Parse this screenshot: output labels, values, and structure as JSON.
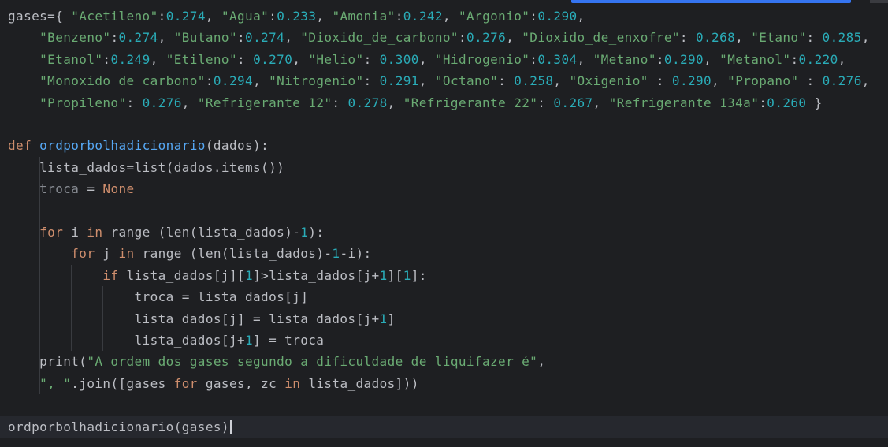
{
  "editor": {
    "colors": {
      "background": "#1e1f22",
      "default": "#bcbec4",
      "keyword": "#cf8e6d",
      "string": "#6aab73",
      "number": "#2aacb8",
      "function": "#56a8f5",
      "dimmed": "#868a91",
      "current_line": "#26282e",
      "accent": "#3574f0"
    },
    "lines": [
      {
        "tokens": [
          {
            "t": "gases={ ",
            "c": "default"
          },
          {
            "t": "\"Acetileno\"",
            "c": "str"
          },
          {
            "t": ":",
            "c": "default"
          },
          {
            "t": "0.274",
            "c": "num"
          },
          {
            "t": ", ",
            "c": "default"
          },
          {
            "t": "\"Agua\"",
            "c": "str"
          },
          {
            "t": ":",
            "c": "default"
          },
          {
            "t": "0.233",
            "c": "num"
          },
          {
            "t": ", ",
            "c": "default"
          },
          {
            "t": "\"Amonia\"",
            "c": "str"
          },
          {
            "t": ":",
            "c": "default"
          },
          {
            "t": "0.242",
            "c": "num"
          },
          {
            "t": ", ",
            "c": "default"
          },
          {
            "t": "\"Argonio\"",
            "c": "str"
          },
          {
            "t": ":",
            "c": "default"
          },
          {
            "t": "0.290",
            "c": "num"
          },
          {
            "t": ",",
            "c": "default"
          }
        ]
      },
      {
        "tokens": [
          {
            "t": "    ",
            "c": "default"
          },
          {
            "t": "\"Benzeno\"",
            "c": "str"
          },
          {
            "t": ":",
            "c": "default"
          },
          {
            "t": "0.274",
            "c": "num"
          },
          {
            "t": ", ",
            "c": "default"
          },
          {
            "t": "\"Butano\"",
            "c": "str"
          },
          {
            "t": ":",
            "c": "default"
          },
          {
            "t": "0.274",
            "c": "num"
          },
          {
            "t": ", ",
            "c": "default"
          },
          {
            "t": "\"Dioxido_de_carbono\"",
            "c": "str"
          },
          {
            "t": ":",
            "c": "default"
          },
          {
            "t": "0.276",
            "c": "num"
          },
          {
            "t": ", ",
            "c": "default"
          },
          {
            "t": "\"Dioxido_de_enxofre\"",
            "c": "str"
          },
          {
            "t": ": ",
            "c": "default"
          },
          {
            "t": "0.268",
            "c": "num"
          },
          {
            "t": ", ",
            "c": "default"
          },
          {
            "t": "\"Etano\"",
            "c": "str"
          },
          {
            "t": ": ",
            "c": "default"
          },
          {
            "t": "0.285",
            "c": "num"
          },
          {
            "t": ",",
            "c": "default"
          }
        ]
      },
      {
        "tokens": [
          {
            "t": "    ",
            "c": "default"
          },
          {
            "t": "\"Etanol\"",
            "c": "str"
          },
          {
            "t": ":",
            "c": "default"
          },
          {
            "t": "0.249",
            "c": "num"
          },
          {
            "t": ", ",
            "c": "default"
          },
          {
            "t": "\"Etileno\"",
            "c": "str"
          },
          {
            "t": ": ",
            "c": "default"
          },
          {
            "t": "0.270",
            "c": "num"
          },
          {
            "t": ", ",
            "c": "default"
          },
          {
            "t": "\"Helio\"",
            "c": "str"
          },
          {
            "t": ": ",
            "c": "default"
          },
          {
            "t": "0.300",
            "c": "num"
          },
          {
            "t": ", ",
            "c": "default"
          },
          {
            "t": "\"Hidrogenio\"",
            "c": "str"
          },
          {
            "t": ":",
            "c": "default"
          },
          {
            "t": "0.304",
            "c": "num"
          },
          {
            "t": ", ",
            "c": "default"
          },
          {
            "t": "\"Metano\"",
            "c": "str"
          },
          {
            "t": ":",
            "c": "default"
          },
          {
            "t": "0.290",
            "c": "num"
          },
          {
            "t": ", ",
            "c": "default"
          },
          {
            "t": "\"Metanol\"",
            "c": "str"
          },
          {
            "t": ":",
            "c": "default"
          },
          {
            "t": "0.220",
            "c": "num"
          },
          {
            "t": ",",
            "c": "default"
          }
        ]
      },
      {
        "tokens": [
          {
            "t": "    ",
            "c": "default"
          },
          {
            "t": "\"Monoxido_de_carbono\"",
            "c": "str"
          },
          {
            "t": ":",
            "c": "default"
          },
          {
            "t": "0.294",
            "c": "num"
          },
          {
            "t": ", ",
            "c": "default"
          },
          {
            "t": "\"Nitrogenio\"",
            "c": "str"
          },
          {
            "t": ": ",
            "c": "default"
          },
          {
            "t": "0.291",
            "c": "num"
          },
          {
            "t": ", ",
            "c": "default"
          },
          {
            "t": "\"Octano\"",
            "c": "str"
          },
          {
            "t": ": ",
            "c": "default"
          },
          {
            "t": "0.258",
            "c": "num"
          },
          {
            "t": ", ",
            "c": "default"
          },
          {
            "t": "\"Oxigenio\"",
            "c": "str"
          },
          {
            "t": " : ",
            "c": "default"
          },
          {
            "t": "0.290",
            "c": "num"
          },
          {
            "t": ", ",
            "c": "default"
          },
          {
            "t": "\"Propano\"",
            "c": "str"
          },
          {
            "t": " : ",
            "c": "default"
          },
          {
            "t": "0.276",
            "c": "num"
          },
          {
            "t": ",",
            "c": "default"
          }
        ]
      },
      {
        "tokens": [
          {
            "t": "    ",
            "c": "default"
          },
          {
            "t": "\"Propileno\"",
            "c": "str"
          },
          {
            "t": ": ",
            "c": "default"
          },
          {
            "t": "0.276",
            "c": "num"
          },
          {
            "t": ", ",
            "c": "default"
          },
          {
            "t": "\"Refrigerante_12\"",
            "c": "str"
          },
          {
            "t": ": ",
            "c": "default"
          },
          {
            "t": "0.278",
            "c": "num"
          },
          {
            "t": ", ",
            "c": "default"
          },
          {
            "t": "\"Refrigerante_22\"",
            "c": "str"
          },
          {
            "t": ": ",
            "c": "default"
          },
          {
            "t": "0.267",
            "c": "num"
          },
          {
            "t": ", ",
            "c": "default"
          },
          {
            "t": "\"Refrigerante_134a\"",
            "c": "str"
          },
          {
            "t": ":",
            "c": "default"
          },
          {
            "t": "0.260",
            "c": "num"
          },
          {
            "t": " }",
            "c": "default"
          }
        ]
      },
      {
        "tokens": []
      },
      {
        "tokens": [
          {
            "t": "def ",
            "c": "kw"
          },
          {
            "t": "ordporbolhadicionario",
            "c": "fn"
          },
          {
            "t": "(dados):",
            "c": "default"
          }
        ]
      },
      {
        "tokens": [
          {
            "t": "    lista_dados=list(dados.items())",
            "c": "default"
          }
        ]
      },
      {
        "tokens": [
          {
            "t": "    ",
            "c": "default"
          },
          {
            "t": "troca",
            "c": "dim"
          },
          {
            "t": " = ",
            "c": "default"
          },
          {
            "t": "None",
            "c": "kw"
          }
        ]
      },
      {
        "tokens": []
      },
      {
        "tokens": [
          {
            "t": "    ",
            "c": "default"
          },
          {
            "t": "for",
            "c": "kw"
          },
          {
            "t": " i ",
            "c": "default"
          },
          {
            "t": "in",
            "c": "kw"
          },
          {
            "t": " range (len(lista_dados)-",
            "c": "default"
          },
          {
            "t": "1",
            "c": "num"
          },
          {
            "t": "):",
            "c": "default"
          }
        ]
      },
      {
        "tokens": [
          {
            "t": "        ",
            "c": "default"
          },
          {
            "t": "for",
            "c": "kw"
          },
          {
            "t": " j ",
            "c": "default"
          },
          {
            "t": "in",
            "c": "kw"
          },
          {
            "t": " range (len(lista_dados)-",
            "c": "default"
          },
          {
            "t": "1",
            "c": "num"
          },
          {
            "t": "-i):",
            "c": "default"
          }
        ]
      },
      {
        "tokens": [
          {
            "t": "            ",
            "c": "default"
          },
          {
            "t": "if",
            "c": "kw"
          },
          {
            "t": " lista_dados[j][",
            "c": "default"
          },
          {
            "t": "1",
            "c": "num"
          },
          {
            "t": "]>lista_dados[j+",
            "c": "default"
          },
          {
            "t": "1",
            "c": "num"
          },
          {
            "t": "][",
            "c": "default"
          },
          {
            "t": "1",
            "c": "num"
          },
          {
            "t": "]:",
            "c": "default"
          }
        ]
      },
      {
        "tokens": [
          {
            "t": "                troca = lista_dados[j]",
            "c": "default"
          }
        ]
      },
      {
        "tokens": [
          {
            "t": "                lista_dados[j] = lista_dados[j+",
            "c": "default"
          },
          {
            "t": "1",
            "c": "num"
          },
          {
            "t": "]",
            "c": "default"
          }
        ]
      },
      {
        "tokens": [
          {
            "t": "                lista_dados[j+",
            "c": "default"
          },
          {
            "t": "1",
            "c": "num"
          },
          {
            "t": "] = troca",
            "c": "default"
          }
        ]
      },
      {
        "tokens": [
          {
            "t": "    print(",
            "c": "default"
          },
          {
            "t": "\"A ordem dos gases segundo a dificuldade de liquifazer é\"",
            "c": "str"
          },
          {
            "t": ",",
            "c": "default"
          }
        ]
      },
      {
        "tokens": [
          {
            "t": "    ",
            "c": "default"
          },
          {
            "t": "\", \"",
            "c": "str"
          },
          {
            "t": ".join([gases ",
            "c": "default"
          },
          {
            "t": "for",
            "c": "kw"
          },
          {
            "t": " gases, zc ",
            "c": "default"
          },
          {
            "t": "in",
            "c": "kw"
          },
          {
            "t": " lista_dados]))",
            "c": "default"
          }
        ]
      },
      {
        "tokens": []
      },
      {
        "tokens": [
          {
            "t": "ordporbolhadicionario(gases)",
            "c": "default"
          }
        ],
        "current": true
      }
    ]
  }
}
